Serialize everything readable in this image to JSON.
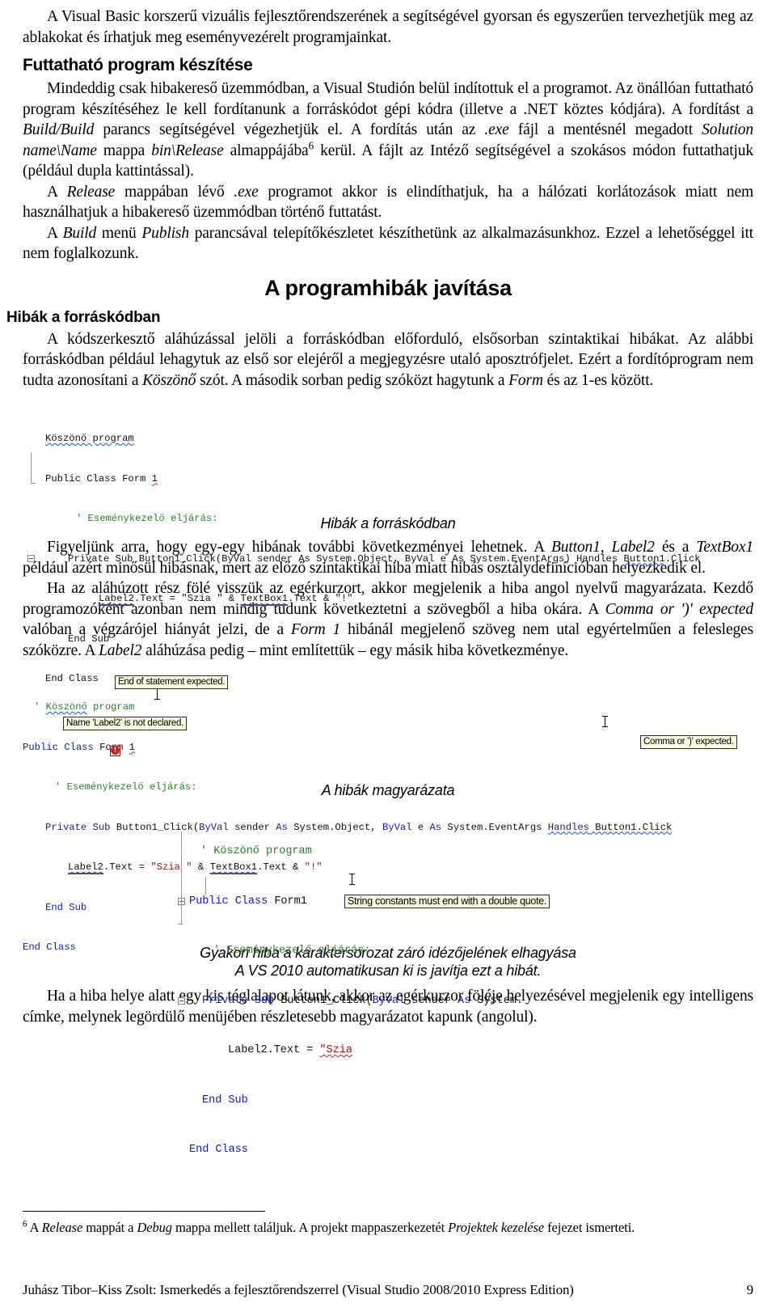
{
  "page": {
    "number": "9",
    "footer_text": "Juhász Tibor–Kiss Zsolt: Ismerkedés a fejlesztőrendszerrel (Visual Studio 2008/2010 Express Edition)"
  },
  "intro": {
    "paragraph": "A Visual Basic korszerű vizuális fejlesztőrendszerének a segítségével gyorsan és egyszerűen tervezhetjük meg az ablakokat és írhatjuk meg eseményvezérelt programjainkat."
  },
  "section_run": {
    "heading": "Futtatható program készítése",
    "p1_a": "Mindeddig csak hibakereső üzemmódban, a Visual Studión belül indítottuk el a programot. Az önállóan futtatható program készítéséhez le kell fordítanunk a forráskódot gépi kódra (illetve a .NET köztes kódjára). A fordítást a ",
    "p1_i1": "Build/Build",
    "p1_b": " parancs segítségével végezhetjük el. A fordítás után az ",
    "p1_i2": ".exe",
    "p1_c": " fájl a mentésnél megadott ",
    "p1_i3": "Solution name\\Name",
    "p1_d": " mappa ",
    "p1_i4": "bin\\Release",
    "p1_e": " almappájába",
    "p1_fn": "6",
    "p1_f": " kerül. A fájlt az Intéző segítségével a szokásos módon futtathatjuk (például dupla kattintással).",
    "p2_a": "A ",
    "p2_i1": "Release",
    "p2_b": " mappában lévő ",
    "p2_i2": ".exe",
    "p2_c": " programot akkor is elindíthatjuk, ha a hálózati korlátozások miatt nem használhatjuk a hibakereső üzemmódban történő futtatást.",
    "p3_a": "A ",
    "p3_i1": "Build",
    "p3_b": " menü ",
    "p3_i2": "Publish",
    "p3_c": " parancsával telepítőkészletet készíthetünk az alkalmazásunkhoz. Ezzel a lehetőséggel itt nem foglalkozunk."
  },
  "chapter": {
    "title": "A programhibák javítása"
  },
  "section_errors": {
    "heading": "Hibák a forráskódban",
    "p1_a": "A kódszerkesztő aláhúzással jelöli a forráskódban előforduló, elsősorban szintaktikai hibákat. Az alábbi forráskódban például lehagytuk az első sor elejéről a megjegyzésre utaló aposztrófjelet. Ezért a fordítóprogram nem tudta azonosítani a ",
    "p1_i1": "Köszönő",
    "p1_b": " szót. A második sorban pedig szóközt hagytunk a ",
    "p1_i2": "Form",
    "p1_c": " és az 1-es között."
  },
  "code1": {
    "caption": "Hibák a forráskódban",
    "lines": [
      {
        "indent": 0,
        "text": "Köszönő program"
      },
      {
        "indent": 0,
        "text": "Public Class Form 1"
      },
      {
        "indent": 1,
        "text": "' Eseménykezelő eljárás:"
      },
      {
        "indent": 1,
        "text": "Private Sub Button1_Click(ByVal sender As System.Object, ByVal e As System.EventArgs) Handles Button1.Click"
      },
      {
        "indent": 2,
        "text": "Label2.Text = \"Szia \" & TextBox1.Text & \"!\""
      },
      {
        "indent": 1,
        "text": "End Sub"
      },
      {
        "indent": 0,
        "text": "End Class"
      }
    ]
  },
  "mid_text": {
    "p1_a": "Figyeljünk arra, hogy egy-egy hibának további következményei lehetnek. A ",
    "p1_i1": "Button1",
    "p1_b": ", ",
    "p1_i2": "Label2",
    "p1_c": " és a ",
    "p1_i3": "TextBox1",
    "p1_d": " például azért minősül hibásnak, mert az előző szintaktikai hiba miatt hibás osztálydefinícióban helyezkedik el.",
    "p2_a": "Ha az aláhúzott rész fölé visszük az egérkurzort, akkor megjelenik a hiba angol nyelvű magyarázata. Kezdő programozóként azonban nem mindig tudunk következtetni a szövegből a hiba okára. A ",
    "p2_i1": "Comma or ')' expected",
    "p2_b": " valóban a végzárójel hiányát jelzi, de a ",
    "p2_i2": "Form 1",
    "p2_c": " hibánál megjelenő szöveg nem utal egyértelműen a felesleges szóközre. A ",
    "p2_i3": "Label2",
    "p2_d": " aláhúzása pedig – mint említettük – egy másik hiba következménye."
  },
  "code2": {
    "caption": "A hibák magyarázata",
    "lines": [
      {
        "indent": 0,
        "text": "' Köszönő program"
      },
      {
        "indent": 0,
        "text": "Public Class Form 1"
      },
      {
        "indent": 1,
        "text": "' Eseménykezelő eljárás:"
      },
      {
        "indent": 1,
        "text": "Private Sub Button1_Click(ByVal sender As System.Object, ByVal e As System.EventArgs Handles Button1.Click"
      },
      {
        "indent": 2,
        "text": "Label2.Text = \"Szia \" & TextBox1.Text & \"!\""
      },
      {
        "indent": 1,
        "text": "End Sub"
      },
      {
        "indent": 0,
        "text": "End Class"
      }
    ],
    "tooltips": [
      "End of statement expected.",
      "Name 'Label2' is not declared.",
      "Comma or ')' expected."
    ]
  },
  "code3": {
    "caption_line1": "Gyakori hiba a karaktersorozat záró idézőjelének elhagyása",
    "caption_line2": "A VS 2010 automatikusan ki is javítja ezt a hibát.",
    "lines": [
      {
        "indent": 0,
        "text": "' Köszönő program"
      },
      {
        "indent": 0,
        "text": "Public Class Form1"
      },
      {
        "indent": 1,
        "text": "' Eseménykezelő eljárás:"
      },
      {
        "indent": 1,
        "text": "Private Sub Button1_Click(ByVal sender As System."
      },
      {
        "indent": 2,
        "text": "Label2.Text = \"Szia"
      },
      {
        "indent": 1,
        "text": "End Sub"
      },
      {
        "indent": 0,
        "text": "End Class"
      }
    ],
    "tooltip": "String constants must end with a double quote."
  },
  "outro": {
    "p1": "Ha a hiba helye alatt egy kis téglalapot látunk, akkor az egérkurzor föléje helyezésével megjelenik egy intelligens címke, melynek legördülő menüjében részletesebb magyarázatot kapunk (angolul)."
  },
  "footnote": {
    "marker": "6",
    "a": " A ",
    "i1": "Release",
    "b": " mappát a ",
    "i2": "Debug",
    "c": " mappa mellett találjuk. A projekt mappaszerkezetét ",
    "i3": "Projektek kezelése",
    "d": " fejezet ismerteti."
  }
}
